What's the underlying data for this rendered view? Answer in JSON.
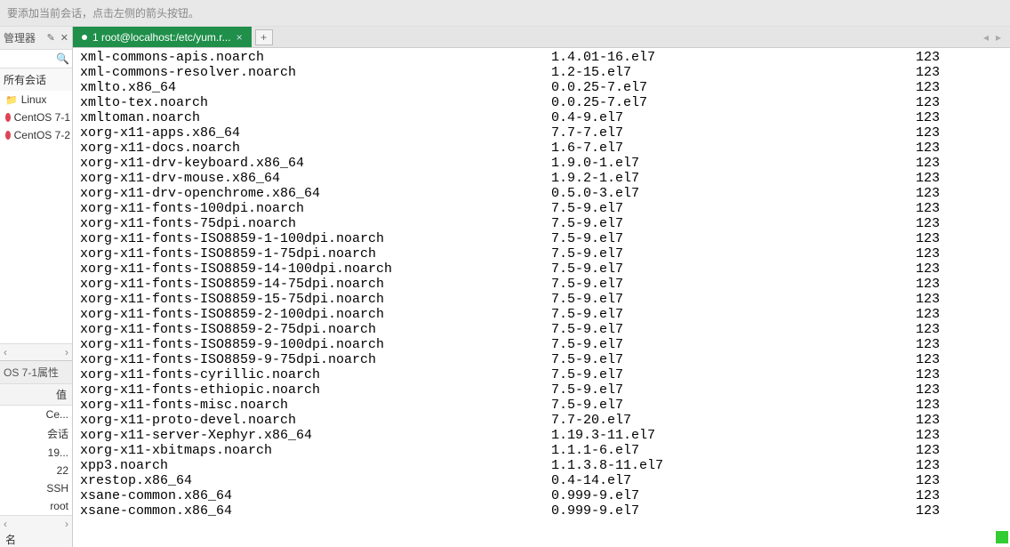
{
  "hint": "要添加当前会话，点击左侧的箭头按钮。",
  "sidebar": {
    "manager_title": "管理器",
    "sessions_title": "所有会话",
    "tree": [
      {
        "type": "folder",
        "label": "Linux"
      },
      {
        "type": "host",
        "label": "CentOS 7-1"
      },
      {
        "type": "host",
        "label": "CentOS 7-2"
      }
    ],
    "props_title": "OS 7-1属性",
    "props_col": "值",
    "props_name_col": "名",
    "props": [
      {
        "v": "Ce..."
      },
      {
        "v": "会话"
      },
      {
        "v": "19..."
      },
      {
        "v": "22"
      },
      {
        "v": "SSH"
      },
      {
        "v": "root"
      }
    ]
  },
  "tab": {
    "label": "1 root@localhost:/etc/yum.r...",
    "add": "+"
  },
  "packages": [
    {
      "name": "xml-commons-apis.noarch",
      "ver": "1.4.01-16.el7",
      "repo": "123"
    },
    {
      "name": "xml-commons-resolver.noarch",
      "ver": "1.2-15.el7",
      "repo": "123"
    },
    {
      "name": "xmlto.x86_64",
      "ver": "0.0.25-7.el7",
      "repo": "123"
    },
    {
      "name": "xmlto-tex.noarch",
      "ver": "0.0.25-7.el7",
      "repo": "123"
    },
    {
      "name": "xmltoman.noarch",
      "ver": "0.4-9.el7",
      "repo": "123"
    },
    {
      "name": "xorg-x11-apps.x86_64",
      "ver": "7.7-7.el7",
      "repo": "123"
    },
    {
      "name": "xorg-x11-docs.noarch",
      "ver": "1.6-7.el7",
      "repo": "123"
    },
    {
      "name": "xorg-x11-drv-keyboard.x86_64",
      "ver": "1.9.0-1.el7",
      "repo": "123"
    },
    {
      "name": "xorg-x11-drv-mouse.x86_64",
      "ver": "1.9.2-1.el7",
      "repo": "123"
    },
    {
      "name": "xorg-x11-drv-openchrome.x86_64",
      "ver": "0.5.0-3.el7",
      "repo": "123"
    },
    {
      "name": "xorg-x11-fonts-100dpi.noarch",
      "ver": "7.5-9.el7",
      "repo": "123"
    },
    {
      "name": "xorg-x11-fonts-75dpi.noarch",
      "ver": "7.5-9.el7",
      "repo": "123"
    },
    {
      "name": "xorg-x11-fonts-ISO8859-1-100dpi.noarch",
      "ver": "7.5-9.el7",
      "repo": "123"
    },
    {
      "name": "xorg-x11-fonts-ISO8859-1-75dpi.noarch",
      "ver": "7.5-9.el7",
      "repo": "123"
    },
    {
      "name": "xorg-x11-fonts-ISO8859-14-100dpi.noarch",
      "ver": "7.5-9.el7",
      "repo": "123"
    },
    {
      "name": "xorg-x11-fonts-ISO8859-14-75dpi.noarch",
      "ver": "7.5-9.el7",
      "repo": "123"
    },
    {
      "name": "xorg-x11-fonts-ISO8859-15-75dpi.noarch",
      "ver": "7.5-9.el7",
      "repo": "123"
    },
    {
      "name": "xorg-x11-fonts-ISO8859-2-100dpi.noarch",
      "ver": "7.5-9.el7",
      "repo": "123"
    },
    {
      "name": "xorg-x11-fonts-ISO8859-2-75dpi.noarch",
      "ver": "7.5-9.el7",
      "repo": "123"
    },
    {
      "name": "xorg-x11-fonts-ISO8859-9-100dpi.noarch",
      "ver": "7.5-9.el7",
      "repo": "123"
    },
    {
      "name": "xorg-x11-fonts-ISO8859-9-75dpi.noarch",
      "ver": "7.5-9.el7",
      "repo": "123"
    },
    {
      "name": "xorg-x11-fonts-cyrillic.noarch",
      "ver": "7.5-9.el7",
      "repo": "123"
    },
    {
      "name": "xorg-x11-fonts-ethiopic.noarch",
      "ver": "7.5-9.el7",
      "repo": "123"
    },
    {
      "name": "xorg-x11-fonts-misc.noarch",
      "ver": "7.5-9.el7",
      "repo": "123"
    },
    {
      "name": "xorg-x11-proto-devel.noarch",
      "ver": "7.7-20.el7",
      "repo": "123"
    },
    {
      "name": "xorg-x11-server-Xephyr.x86_64",
      "ver": "1.19.3-11.el7",
      "repo": "123"
    },
    {
      "name": "xorg-x11-xbitmaps.noarch",
      "ver": "1.1.1-6.el7",
      "repo": "123"
    },
    {
      "name": "xpp3.noarch",
      "ver": "1.1.3.8-11.el7",
      "repo": "123"
    },
    {
      "name": "xrestop.x86_64",
      "ver": "0.4-14.el7",
      "repo": "123"
    },
    {
      "name": "xsane-common.x86_64",
      "ver": "0.999-9.el7",
      "repo": "123"
    },
    {
      "name": "xsane-common.x86_64",
      "ver": "0.999-9.el7",
      "repo": "123"
    }
  ]
}
